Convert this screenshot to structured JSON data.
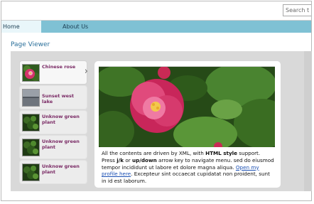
{
  "search": {
    "placeholder": "Search t"
  },
  "nav": {
    "items": [
      {
        "label": "Home"
      },
      {
        "label": "About Us"
      }
    ]
  },
  "page": {
    "title": "Page Viewer"
  },
  "list": {
    "items": [
      {
        "label": "Chinese rose",
        "icon": "rose-thumbnail",
        "selected": true
      },
      {
        "label": "Sunset west lake",
        "icon": "lake-thumbnail",
        "selected": false
      },
      {
        "label": "Unknow green plant",
        "icon": "plant-thumbnail",
        "selected": false
      },
      {
        "label": "Unknow green plant",
        "icon": "plant-thumbnail",
        "selected": false
      },
      {
        "label": "Unknow green plant",
        "icon": "plant-thumbnail",
        "selected": false
      }
    ]
  },
  "detail": {
    "photo_icon": "rose-photo",
    "text_1": "All the contents are driven by XML, with ",
    "bold_1": "HTML style",
    "text_2": " support. Press ",
    "bold_2": "j/k",
    "text_3": " or ",
    "bold_3": "up/down",
    "text_4": " arrow key to navigate menu. sed do eiusmod tempor incididunt ut labore et dolore magna aliqua. ",
    "link": "Open my profile here",
    "text_5": ". Excepteur sint occaecat cupidatat non proident, sunt in id est laborum."
  },
  "colors": {
    "nav_bar": "#7fc1d4",
    "nav_active": "#e9f6fa",
    "page_title": "#2a6f9a",
    "item_label": "#7a2a65",
    "link": "#1a4fb3",
    "viewer_bg": "#d9d9d9"
  }
}
